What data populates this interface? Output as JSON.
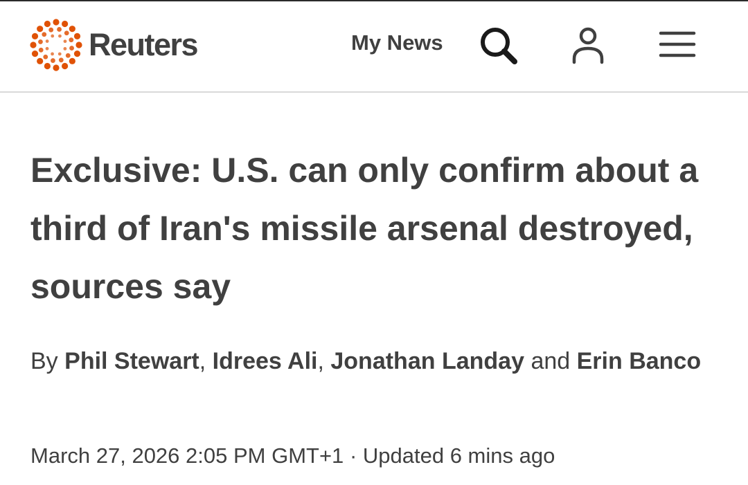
{
  "header": {
    "brand": "Reuters",
    "my_news_label": "My News",
    "icons": [
      "reuters-logo-icon",
      "search-icon",
      "account-icon",
      "menu-icon"
    ],
    "logo_color": "#e05206"
  },
  "article": {
    "headline": "Exclusive: U.S. can only confirm about a third of Iran's missile arsenal destroyed, sources say",
    "byline": {
      "prefix": "By",
      "authors": [
        "Phil Stewart",
        "Idrees Ali",
        "Jonathan Landay",
        "Erin Banco"
      ],
      "separator": ",",
      "conjunction": "and"
    },
    "published": "March 27, 2026 2:05 PM GMT+1",
    "dot_separator": "·",
    "updated": "Updated 6 mins ago"
  }
}
